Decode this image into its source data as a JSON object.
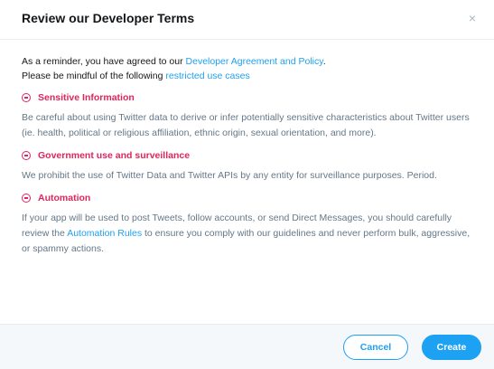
{
  "dialog": {
    "title": "Review our Developer Terms",
    "close_label": "×"
  },
  "intro": {
    "line1_prefix": "As a reminder, you have agreed to our ",
    "line1_link": "Developer Agreement and Policy",
    "line1_suffix": ".",
    "line2_prefix": "Please be mindful of the following ",
    "line2_link": "restricted use cases",
    "line2_suffix": ""
  },
  "sections": [
    {
      "heading": "Sensitive Information",
      "text": "Be careful about using Twitter data to derive or infer potentially sensitive characteristics about Twitter users (ie. health, political or religious affiliation, ethnic origin, sexual orientation, and more)."
    },
    {
      "heading": "Government use and surveillance",
      "text": "We prohibit the use of Twitter Data and Twitter APIs by any entity for surveillance purposes. Period."
    },
    {
      "heading": "Automation",
      "text_prefix": "If your app will be used to post Tweets, follow accounts, or send Direct Messages, you should carefully review the ",
      "text_link": "Automation Rules",
      "text_suffix": " to ensure you comply with our guidelines and never perform bulk, aggressive, or spammy actions."
    }
  ],
  "footer": {
    "cancel_label": "Cancel",
    "create_label": "Create"
  },
  "colors": {
    "accent": "#1da1f2",
    "warning": "#e0245e",
    "muted_text": "#657786"
  }
}
